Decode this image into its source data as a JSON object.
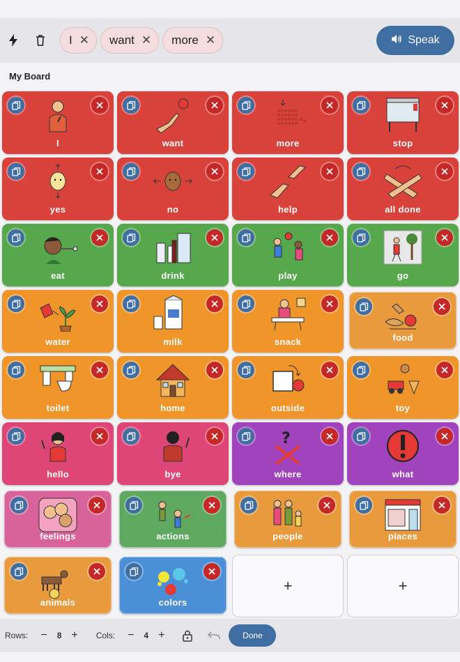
{
  "toolbar": {
    "chips": [
      {
        "label": "I"
      },
      {
        "label": "want"
      },
      {
        "label": "more"
      }
    ],
    "speak_label": "Speak"
  },
  "board": {
    "title": "My Board",
    "tiles": [
      {
        "label": "I",
        "color": "#d9413b",
        "icon": "pointing-self-icon"
      },
      {
        "label": "want",
        "color": "#d9413b",
        "icon": "reaching-hand-icon"
      },
      {
        "label": "more",
        "color": "#d9413b",
        "icon": "more-dots-icon"
      },
      {
        "label": "stop",
        "color": "#d9413b",
        "icon": "bus-stop-icon"
      },
      {
        "label": "yes",
        "color": "#d9413b",
        "icon": "nodding-head-icon"
      },
      {
        "label": "no",
        "color": "#d9413b",
        "icon": "shaking-head-icon"
      },
      {
        "label": "help",
        "color": "#d9413b",
        "icon": "helping-hands-icon"
      },
      {
        "label": "all done",
        "color": "#d9413b",
        "icon": "crossed-arms-icon"
      },
      {
        "label": "eat",
        "color": "#57a84c",
        "icon": "eating-icon"
      },
      {
        "label": "drink",
        "color": "#57a84c",
        "icon": "drinks-icon"
      },
      {
        "label": "play",
        "color": "#57a84c",
        "icon": "playing-ball-icon"
      },
      {
        "label": "go",
        "color": "#57a84c",
        "icon": "walking-icon"
      },
      {
        "label": "water",
        "color": "#f0952a",
        "icon": "watering-can-icon"
      },
      {
        "label": "milk",
        "color": "#f0952a",
        "icon": "milk-carton-icon"
      },
      {
        "label": "snack",
        "color": "#f0952a",
        "icon": "snack-table-icon"
      },
      {
        "label": "food",
        "color": "#e89a3c",
        "icon": "food-icon",
        "inset": true
      },
      {
        "label": "toilet",
        "color": "#f0952a",
        "icon": "toilet-icon"
      },
      {
        "label": "home",
        "color": "#f0952a",
        "icon": "house-icon"
      },
      {
        "label": "outside",
        "color": "#f0952a",
        "icon": "outside-square-icon"
      },
      {
        "label": "toy",
        "color": "#f0952a",
        "icon": "toys-icon"
      },
      {
        "label": "hello",
        "color": "#de4678",
        "icon": "waving-girl-icon"
      },
      {
        "label": "bye",
        "color": "#de4678",
        "icon": "waving-back-icon"
      },
      {
        "label": "where",
        "color": "#a043bd",
        "icon": "question-cross-icon"
      },
      {
        "label": "what",
        "color": "#a043bd",
        "icon": "exclamation-icon"
      },
      {
        "label": "feelings",
        "color": "#d8639a",
        "icon": "faces-icon",
        "inset": true
      },
      {
        "label": "actions",
        "color": "#5ea860",
        "icon": "actions-people-icon",
        "inset": true
      },
      {
        "label": "people",
        "color": "#e89a3c",
        "icon": "family-icon",
        "inset": true
      },
      {
        "label": "places",
        "color": "#e89a3c",
        "icon": "shop-front-icon",
        "inset": true
      },
      {
        "label": "animals",
        "color": "#e89a3c",
        "icon": "animals-icon",
        "inset": true
      },
      {
        "label": "colors",
        "color": "#4b8fd6",
        "icon": "paint-splash-icon",
        "inset": true
      }
    ],
    "empty_tiles": [
      "+",
      "+"
    ]
  },
  "bottom": {
    "rows_label": "Rows:",
    "rows_value": "8",
    "cols_label": "Cols:",
    "cols_value": "4",
    "minus": "−",
    "plus": "+",
    "done_label": "Done"
  },
  "colors": {
    "accent": "#3f6ea2",
    "delete": "#c62828"
  }
}
